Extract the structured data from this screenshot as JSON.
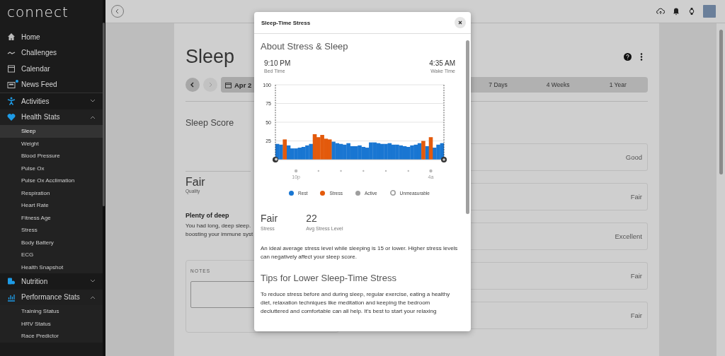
{
  "sidebar": {
    "logo": "connect",
    "items": [
      {
        "label": "Home"
      },
      {
        "label": "Challenges"
      },
      {
        "label": "Calendar"
      },
      {
        "label": "News Feed",
        "has_notification": true
      }
    ],
    "sections": [
      {
        "label": "Activities",
        "expanded": false
      },
      {
        "label": "Health Stats",
        "expanded": true,
        "children": [
          {
            "label": "Sleep",
            "selected": true
          },
          {
            "label": "Weight",
            "selected": false
          },
          {
            "label": "Blood Pressure",
            "selected": false
          },
          {
            "label": "Pulse Ox",
            "selected": false
          },
          {
            "label": "Pulse Ox Acclimation",
            "selected": false
          },
          {
            "label": "Respiration",
            "selected": false
          },
          {
            "label": "Heart Rate",
            "selected": false
          },
          {
            "label": "Fitness Age",
            "selected": false
          },
          {
            "label": "Stress",
            "selected": false
          },
          {
            "label": "Body Battery",
            "selected": false
          },
          {
            "label": "ECG",
            "selected": false
          },
          {
            "label": "Health Snapshot",
            "selected": false
          }
        ]
      },
      {
        "label": "Nutrition",
        "expanded": false
      },
      {
        "label": "Performance Stats",
        "expanded": true,
        "children": [
          {
            "label": "Training Status",
            "selected": false
          },
          {
            "label": "HRV Status",
            "selected": false
          },
          {
            "label": "Race Predictor",
            "selected": false
          }
        ]
      }
    ]
  },
  "page": {
    "title": "Sleep",
    "date_button": "Apr 2",
    "tabs": [
      {
        "label": "7 Days",
        "selected": false
      },
      {
        "label": "4 Weeks",
        "selected": false
      },
      {
        "label": "1 Year",
        "selected": false
      }
    ],
    "score_heading": "Sleep Score",
    "quality_value": "Fair",
    "quality_label": "Quality",
    "insight_title": "Plenty of deep",
    "insight_lines": [
      "You had long, deep sleep.",
      "boosting your immune syst"
    ],
    "notes_label": "NOTES",
    "rows": [
      {
        "value": "Good"
      },
      {
        "value": "Fair"
      },
      {
        "value": "Excellent"
      },
      {
        "value": "Fair"
      },
      {
        "value": "Fair"
      }
    ]
  },
  "modal": {
    "title": "Sleep-Time Stress",
    "heading": "About Stress & Sleep",
    "bed_time": "9:10 PM",
    "bed_time_label": "Bed Time",
    "wake_time": "4:35 AM",
    "wake_time_label": "Wake Time",
    "chart_data": {
      "type": "bar",
      "grid": true,
      "ylim": [
        0,
        100
      ],
      "yticks": [
        25,
        50,
        75,
        100
      ],
      "categories": [
        null,
        null,
        null,
        null,
        null,
        "10p",
        null,
        null,
        null,
        null,
        null,
        null,
        null,
        null,
        null,
        null,
        null,
        null,
        null,
        null,
        null,
        null,
        null,
        null,
        null,
        null,
        null,
        null,
        null,
        null,
        null,
        null,
        null,
        null,
        null,
        null,
        null,
        null,
        null,
        null,
        null,
        "4a",
        null,
        null,
        null
      ],
      "series": [
        {
          "name": "Rest",
          "color": "#1976d2",
          "values": [
            21,
            20,
            null,
            19,
            15,
            15,
            16,
            17,
            19,
            21,
            null,
            null,
            null,
            null,
            null,
            24,
            22,
            21,
            20,
            22,
            18,
            18,
            19,
            17,
            16,
            23,
            23,
            22,
            21,
            21,
            22,
            20,
            20,
            19,
            18,
            17,
            19,
            20,
            22,
            null,
            18,
            null,
            16,
            20,
            22
          ]
        },
        {
          "name": "Stress",
          "color": "#e35a0c",
          "values": [
            null,
            null,
            27,
            null,
            null,
            null,
            null,
            null,
            null,
            null,
            34,
            30,
            33,
            28,
            27,
            null,
            null,
            null,
            null,
            null,
            null,
            null,
            null,
            null,
            null,
            null,
            null,
            null,
            null,
            null,
            null,
            null,
            null,
            null,
            null,
            null,
            null,
            null,
            null,
            25,
            null,
            30,
            null,
            null,
            null
          ]
        }
      ]
    },
    "legend_extra": [
      {
        "label": "Active",
        "color": "#9e9e9e",
        "kind": "filled"
      },
      {
        "label": "Unmeasurable",
        "color": "#9e9e9e",
        "kind": "hollow"
      }
    ],
    "stats": [
      {
        "value": "Fair",
        "label": "Stress"
      },
      {
        "value": "22",
        "label": "Avg Stress Level"
      }
    ],
    "paragraph": "An ideal average stress level while sleeping is 15 or lower. Higher stress levels can negatively affect your sleep score.",
    "tips_heading": "Tips for Lower Sleep-Time Stress",
    "tips_paragraph": "To reduce stress before and during sleep, regular exercise, eating a healthy diet, relaxation techniques like meditation and keeping the bedroom decluttered and comfortable can all help. It's best to start your relaxing"
  }
}
